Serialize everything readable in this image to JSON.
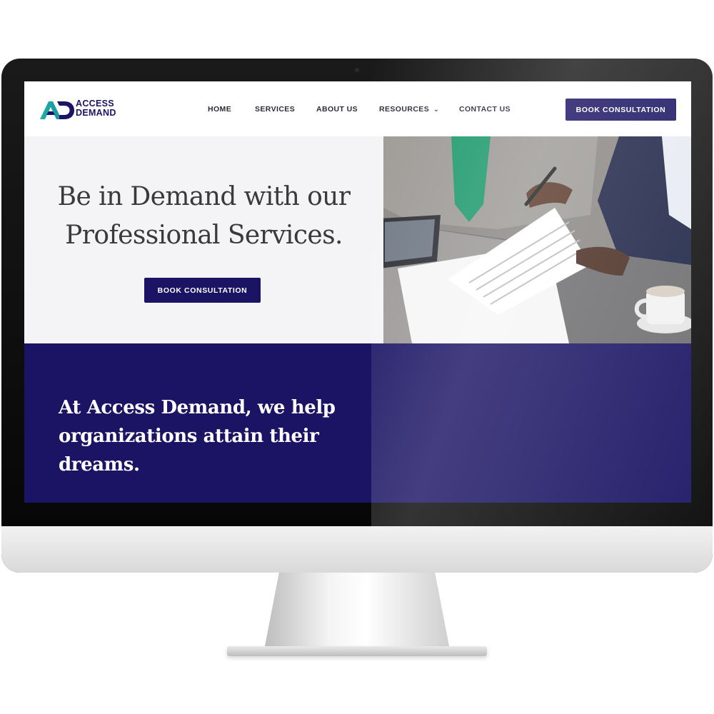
{
  "brand": {
    "name_line1": "ACCESS",
    "name_line2": "DEMAND",
    "logo_letters": "AD",
    "primary_color": "#1b1464",
    "accent_color": "#1fb5a4"
  },
  "nav": {
    "items": [
      {
        "label": "HOME"
      },
      {
        "label": "SERVICES"
      },
      {
        "label": "ABOUT US"
      },
      {
        "label": "RESOURCES",
        "has_dropdown": true
      },
      {
        "label": "CONTACT US"
      }
    ],
    "cta_label": "BOOK CONSULTATION"
  },
  "hero": {
    "title": "Be in Demand with our Professional Services.",
    "cta_label": "BOOK CONSULTATION",
    "image": "business-meeting-documents-photo"
  },
  "band": {
    "text": "At Access Demand, we help organizations attain their dreams."
  }
}
